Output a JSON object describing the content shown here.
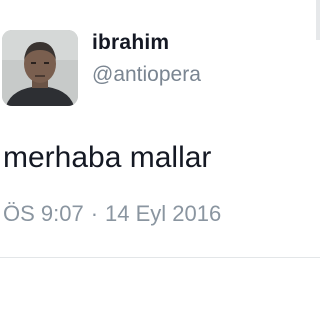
{
  "tweet": {
    "author_name": "ibrahim",
    "author_handle": "@antiopera",
    "text": "merhaba mallar",
    "time": "ÖS 9:07",
    "separator": "·",
    "date": "14 Eyl 2016"
  },
  "icons": {
    "avatar": "profile-photo"
  }
}
